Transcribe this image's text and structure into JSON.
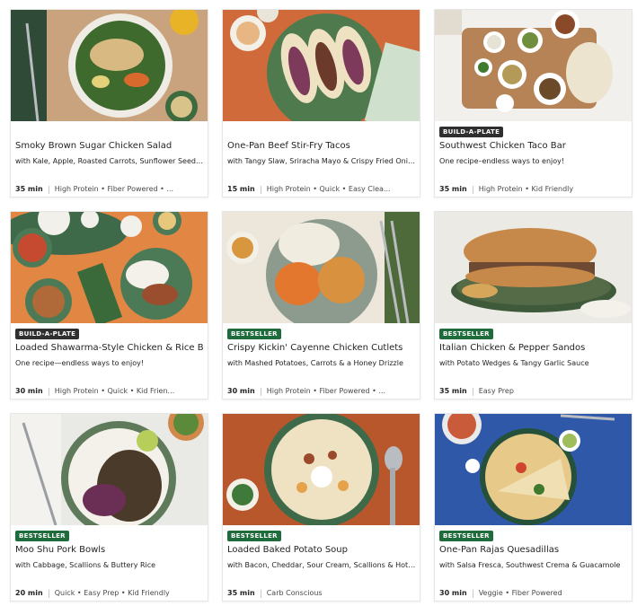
{
  "recipes": [
    {
      "badge": "",
      "title": "Smoky Brown Sugar Chicken Salad",
      "subtitle": "with Kale, Apple, Roasted Carrots, Sunflower Seeds ...",
      "time": "35 min",
      "tags": "High Protein • Fiber Powered • ..."
    },
    {
      "badge": "",
      "title": "One-Pan Beef Stir-Fry Tacos",
      "subtitle": "with Tangy Slaw, Sriracha Mayo & Crispy Fried Onions",
      "time": "15 min",
      "tags": "High Protein • Quick • Easy Clea..."
    },
    {
      "badge": "BUILD-A-PLATE",
      "title": "Southwest Chicken Taco Bar",
      "subtitle": "One recipe–endless ways to enjoy!",
      "time": "35 min",
      "tags": "High Protein • Kid Friendly"
    },
    {
      "badge": "BUILD-A-PLATE",
      "title": "Loaded Shawarma-Style Chicken & Rice Bar",
      "subtitle": "One recipe—endless ways to enjoy!",
      "time": "30 min",
      "tags": "High Protein • Quick • Kid Frien..."
    },
    {
      "badge": "BESTSELLER",
      "title": "Crispy Kickin' Cayenne Chicken Cutlets",
      "subtitle": "with Mashed Potatoes, Carrots & a Honey Drizzle",
      "time": "30 min",
      "tags": "High Protein • Fiber Powered • ..."
    },
    {
      "badge": "BESTSELLER",
      "title": "Italian Chicken & Pepper Sandos",
      "subtitle": "with Potato Wedges & Tangy Garlic Sauce",
      "time": "35 min",
      "tags": "Easy Prep"
    },
    {
      "badge": "BESTSELLER",
      "title": "Moo Shu Pork Bowls",
      "subtitle": "with Cabbage, Scallions & Buttery Rice",
      "time": "20 min",
      "tags": "Quick • Easy Prep • Kid Friendly"
    },
    {
      "badge": "BESTSELLER",
      "title": "Loaded Baked Potato Soup",
      "subtitle": "with Bacon, Cheddar, Sour Cream, Scallions & Hot S...",
      "time": "35 min",
      "tags": "Carb Conscious"
    },
    {
      "badge": "BESTSELLER",
      "title": "One-Pan Rajas Quesadillas",
      "subtitle": "with Salsa Fresca, Southwest Crema & Guacamole",
      "time": "30 min",
      "tags": "Veggie • Fiber Powered"
    }
  ],
  "colors": {
    "bestseller_badge": "#1e6b3b",
    "build_a_plate_badge": "#2f2f2f"
  }
}
